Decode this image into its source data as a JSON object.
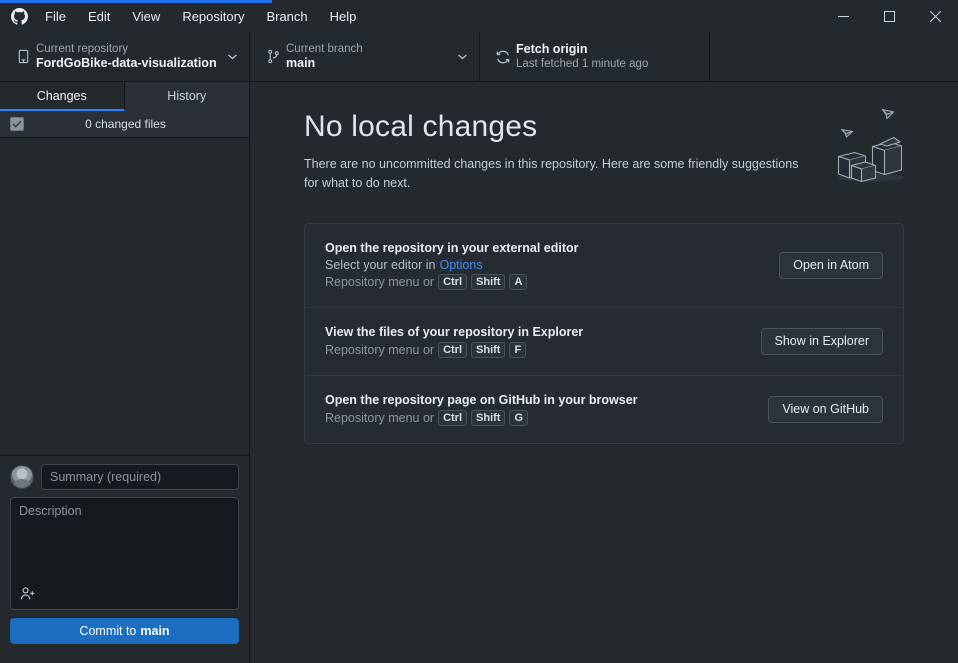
{
  "titlebar": {
    "logo_icon": "github-mark-icon",
    "menu": [
      {
        "label": "File"
      },
      {
        "label": "Edit"
      },
      {
        "label": "View"
      },
      {
        "label": "Repository"
      },
      {
        "label": "Branch"
      },
      {
        "label": "Help"
      }
    ],
    "window_controls": {
      "minimize": "minimize-icon",
      "maximize": "maximize-icon",
      "close": "close-icon"
    }
  },
  "toolbar": {
    "repository": {
      "icon": "repo-icon",
      "label": "Current repository",
      "value": "FordGoBike-data-visualization",
      "caret": "chevron-down-icon"
    },
    "branch": {
      "icon": "branch-icon",
      "label": "Current branch",
      "value": "main",
      "caret": "chevron-down-icon"
    },
    "fetch": {
      "icon": "sync-icon",
      "title": "Fetch origin",
      "subtitle": "Last fetched 1 minute ago"
    }
  },
  "sidebar": {
    "tabs": [
      {
        "label": "Changes",
        "active": true
      },
      {
        "label": "History",
        "active": false
      }
    ],
    "changed_files": {
      "checkbox_icon": "checkmark-icon",
      "label": "0 changed files"
    },
    "commit": {
      "avatar": "user-avatar",
      "summary_placeholder": "Summary (required)",
      "summary_value": "",
      "description_placeholder": "Description",
      "description_value": "",
      "coauthor_icon": "add-person-icon",
      "button_prefix": "Commit to",
      "button_branch": "main"
    }
  },
  "main": {
    "title": "No local changes",
    "description": "There are no uncommitted changes in this repository. Here are some friendly suggestions for what to do next.",
    "illustration_icon": "boxes-and-paper-planes-illustration",
    "suggestions": [
      {
        "title": "Open the repository in your external editor",
        "line_prefix": "Select your editor in ",
        "link": "Options",
        "shortcut_prefix": "Repository menu or",
        "keys": [
          "Ctrl",
          "Shift",
          "A"
        ],
        "button": "Open in Atom"
      },
      {
        "title": "View the files of your repository in Explorer",
        "line_prefix": "",
        "link": "",
        "shortcut_prefix": "Repository menu or",
        "keys": [
          "Ctrl",
          "Shift",
          "F"
        ],
        "button": "Show in Explorer"
      },
      {
        "title": "Open the repository page on GitHub in your browser",
        "line_prefix": "",
        "link": "",
        "shortcut_prefix": "Repository menu or",
        "keys": [
          "Ctrl",
          "Shift",
          "G"
        ],
        "button": "View on GitHub"
      }
    ]
  },
  "colors": {
    "background": "#24292e",
    "accent_blue": "#1f6feb",
    "link_blue": "#3b8eea",
    "tab_active_underline": "#2188ff",
    "commit_button": "#1b6ec2"
  }
}
